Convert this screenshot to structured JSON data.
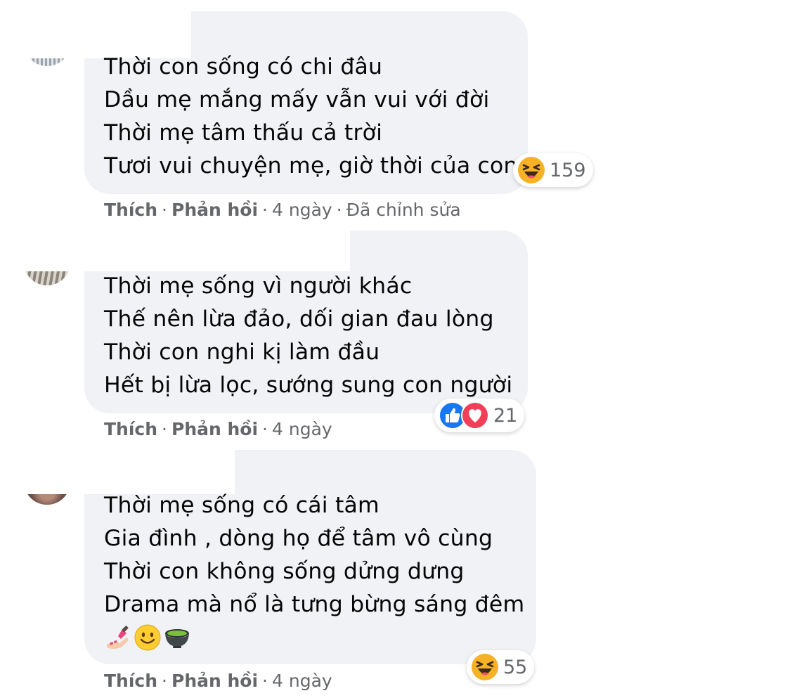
{
  "comments": [
    {
      "lines": [
        "Thời con sống có chi đâu",
        "Dầu mẹ mắng mấy vẫn vui với đời",
        "Thời mẹ tâm thấu cả trời",
        "Tươi vui chuyện mẹ, giờ thời của con"
      ],
      "reactions": {
        "icons": [
          "haha-emoji-icon"
        ],
        "count": "159"
      },
      "actions": {
        "like": "Thích",
        "reply": "Phản hồi",
        "time": "4 ngày",
        "edited": "Đã chỉnh sửa"
      }
    },
    {
      "lines": [
        "Thời mẹ sống vì người khác",
        "Thế nên lừa đảo, dối gian đau lòng",
        "Thời con nghi kị làm đầu",
        "Hết bị lừa lọc, sướng sung con người"
      ],
      "reactions": {
        "icons": [
          "like-icon",
          "love-icon"
        ],
        "count": "21"
      },
      "actions": {
        "like": "Thích",
        "reply": "Phản hồi",
        "time": "4 ngày"
      }
    },
    {
      "lines": [
        "Thời mẹ sống có cái tâm",
        "Gia đình , dòng họ để tâm vô cùng",
        "Thời con không sống dửng dưng",
        "Drama mà nổ là tưng bừng sáng đêm"
      ],
      "emoji_line": [
        "nail-polish-emoji-icon",
        "slightly-smiling-emoji-icon",
        "tea-bowl-emoji-icon"
      ],
      "reactions": {
        "icons": [
          "haha-emoji-icon"
        ],
        "count": "55"
      },
      "actions": {
        "like": "Thích",
        "reply": "Phản hồi",
        "time": "4 ngày"
      }
    }
  ],
  "colors": {
    "bubble": "#f0f2f5",
    "meta_text": "#65676b",
    "like_blue": "#1877f2",
    "love_red": "#f33e58",
    "haha_yellow": "#f7b125"
  }
}
